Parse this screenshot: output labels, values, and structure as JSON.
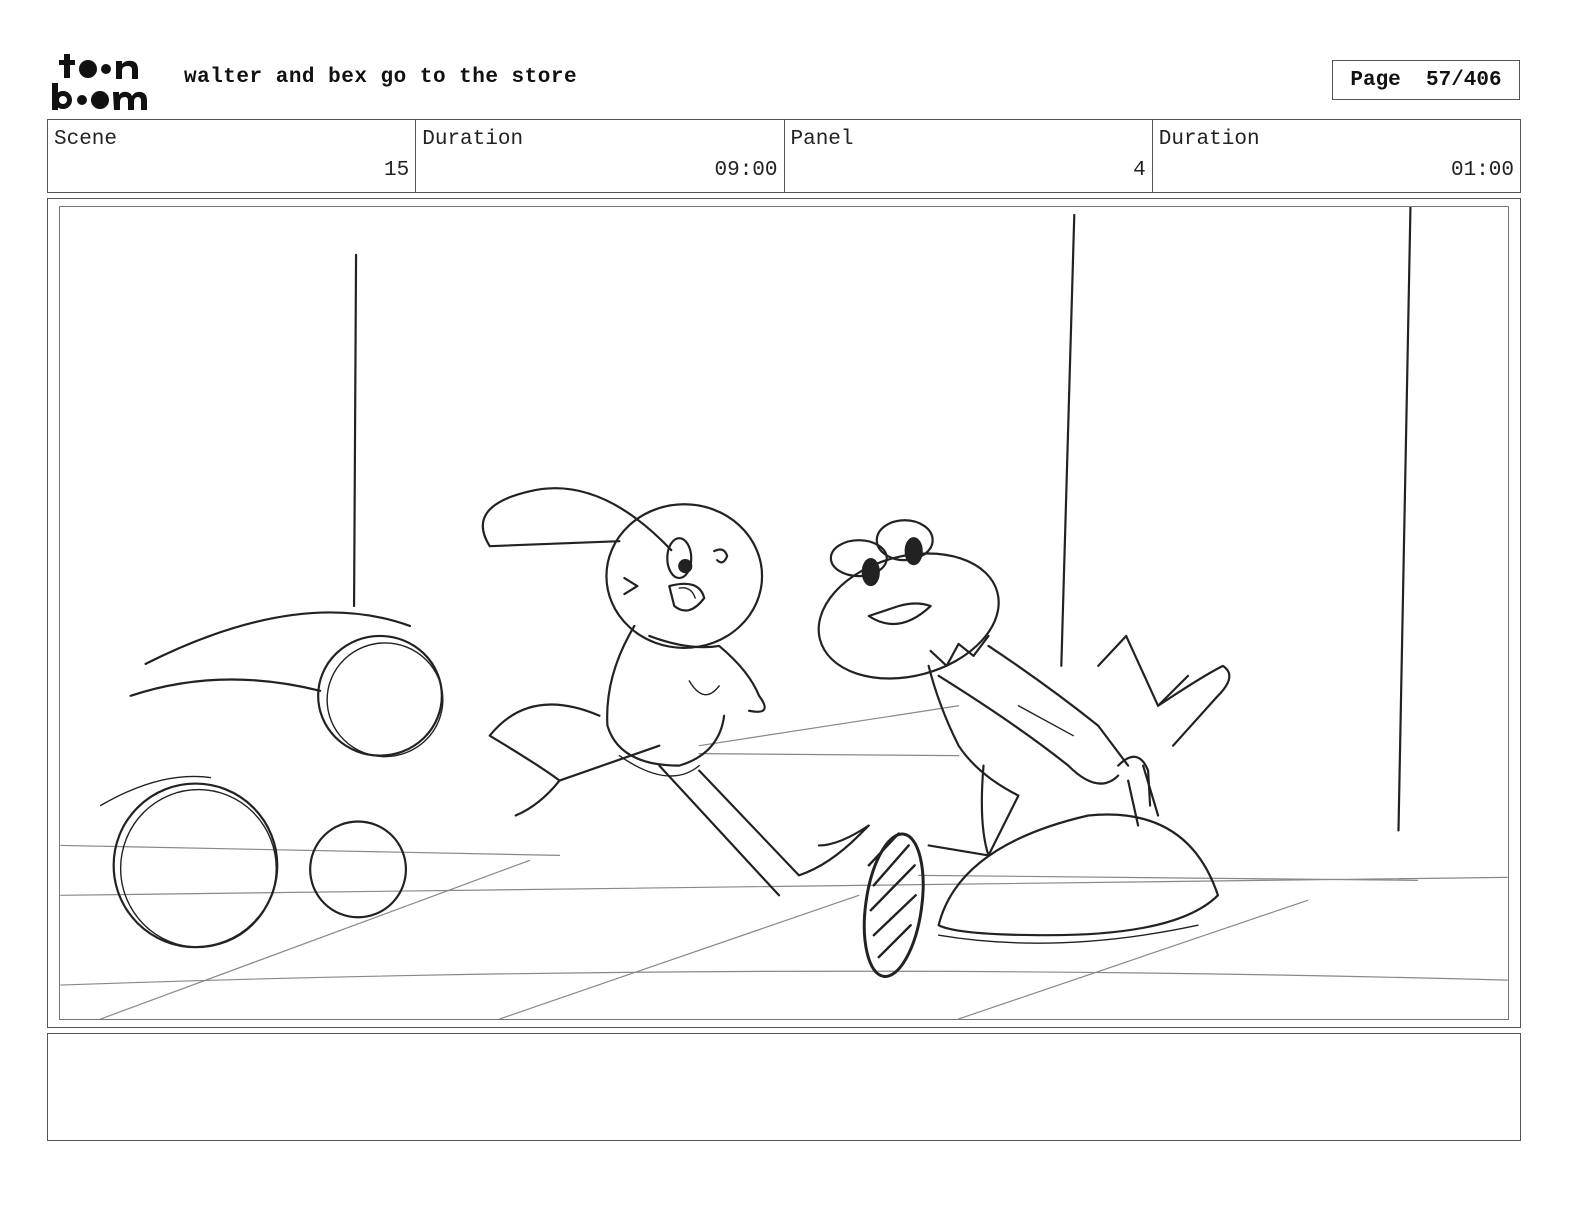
{
  "header": {
    "logo_text": [
      "toon",
      "boom"
    ],
    "title": "walter and bex go to the store",
    "page_label": "Page",
    "page_value": "57/406"
  },
  "info": {
    "scene_label": "Scene",
    "scene_value": "15",
    "scene_duration_label": "Duration",
    "scene_duration_value": "09:00",
    "panel_label": "Panel",
    "panel_value": "4",
    "panel_duration_label": "Duration",
    "panel_duration_value": "01:00"
  },
  "panel": {
    "icon": "storyboard-sketch-image"
  },
  "notes": {
    "text": ""
  }
}
